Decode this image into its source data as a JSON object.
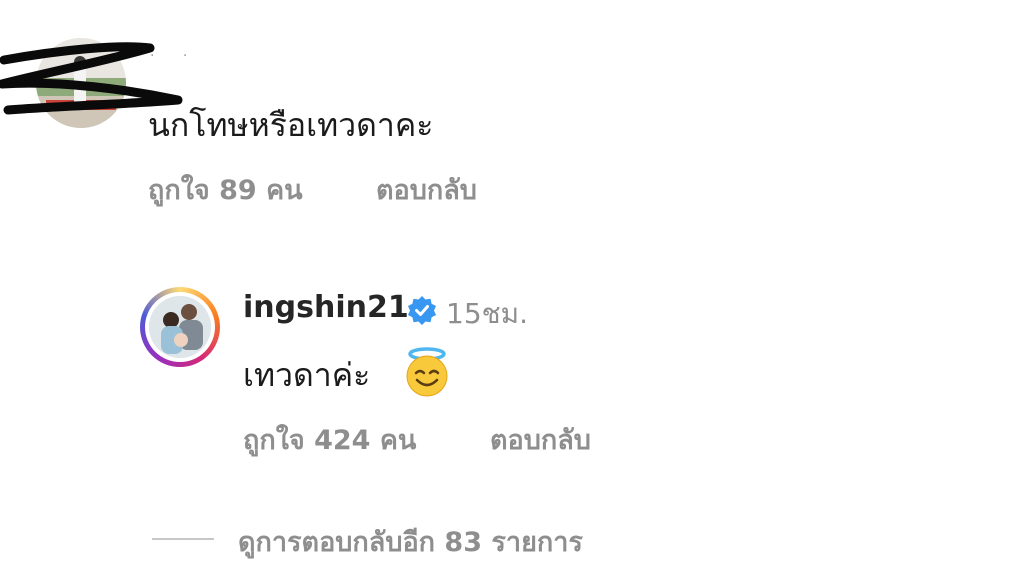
{
  "comment": {
    "username": ". .",
    "text": "นกโทษหรือเทวดาคะ",
    "likes": "ถูกใจ 89 คน",
    "reply_label": "ตอบกลับ"
  },
  "reply": {
    "username": "ingshin21",
    "verified_icon": "verified-badge-icon",
    "time": "15ชม.",
    "text": "เทวดาค่ะ",
    "emoji": "smiling-face-with-halo-icon",
    "likes": "ถูกใจ 424 คน",
    "reply_label": "ตอบกลับ"
  },
  "more_replies": {
    "label": "ดูการตอบกลับอีก 83 รายการ"
  },
  "colors": {
    "primary_text": "#262626",
    "secondary_text": "#8e8e8e",
    "verified_blue": "#3897f0"
  }
}
